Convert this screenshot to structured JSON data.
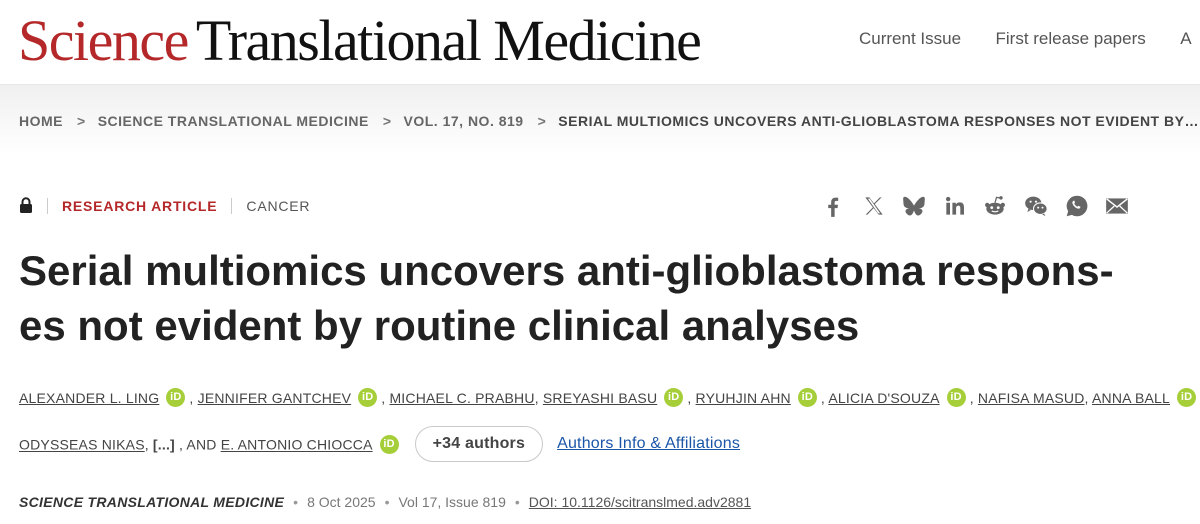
{
  "header": {
    "logo_science": "Science",
    "logo_rest": "Translational Medicine",
    "nav": [
      "Current Issue",
      "First release papers",
      "A"
    ]
  },
  "breadcrumb": [
    "HOME",
    "SCIENCE TRANSLATIONAL MEDICINE",
    "VOL. 17, NO. 819",
    "SERIAL MULTIOMICS UNCOVERS ANTI-GLIOBLASTOMA RESPONSES NOT EVIDENT BY…"
  ],
  "article": {
    "type": "RESEARCH ARTICLE",
    "subject": "CANCER",
    "title_line1": "Serial multiomics uncovers anti-glioblastoma respons-",
    "title_line2": "es not evident by routine clinical analyses"
  },
  "share_icons": [
    "facebook-icon",
    "x-icon",
    "bluesky-icon",
    "linkedin-icon",
    "reddit-icon",
    "wechat-icon",
    "whatsapp-icon",
    "email-icon"
  ],
  "authors": {
    "a1": "ALEXANDER L. LING",
    "a2": "JENNIFER GANTCHEV",
    "a3": "MICHAEL C. PRABHU",
    "a4": "SREYASHI BASU",
    "a5": "RYUHJIN AHN",
    "a6": "ALICIA D'SOUZA",
    "a7": "NAFISA MASUD",
    "a8": "ANNA BALL",
    "a9": "ODYSSEAS NIKAS",
    "ellipsis": "[...]",
    "and": "AND",
    "a10": "E. ANTONIO CHIOCCA",
    "orcid_label": "iD",
    "more_button": "+34 authors",
    "affiliations_link": "Authors Info & Affiliations"
  },
  "publication": {
    "journal": "SCIENCE TRANSLATIONAL MEDICINE",
    "date": "8 Oct 2025",
    "volume": "Vol 17, Issue 819",
    "doi": "DOI: 10.1126/scitranslmed.adv2881"
  },
  "colors": {
    "brand_red": "#b5282a",
    "orcid_green": "#a6ce39",
    "link_blue": "#1a56a8"
  }
}
